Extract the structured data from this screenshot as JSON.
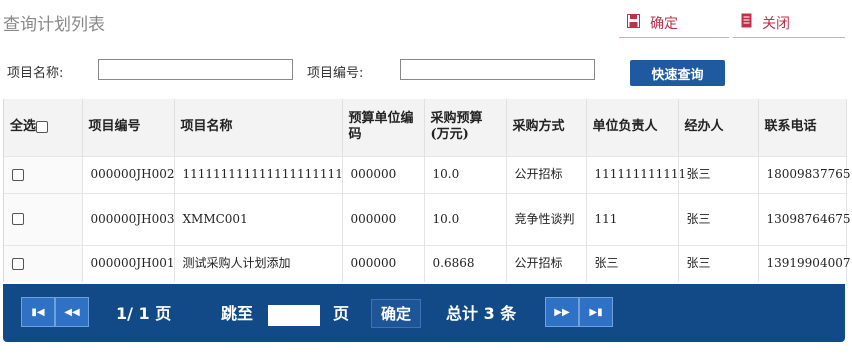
{
  "header": {
    "title": "查询计划列表",
    "confirm_label": "确定",
    "close_label": "关闭",
    "confirm_icon": "save-icon",
    "close_icon": "document-icon",
    "accent": "#c0304a"
  },
  "search": {
    "name_label": "项目名称:",
    "name_value": "",
    "code_label": "项目编号:",
    "code_value": "",
    "button_label": "快速查询"
  },
  "table": {
    "headers": [
      "全选",
      "项目编号",
      "项目名称",
      "预算单位编码",
      "采购预算(万元)",
      "采购方式",
      "单位负责人",
      "经办人",
      "联系电话"
    ],
    "rows": [
      [
        "",
        "000000JH002",
        "111111111111111111111",
        "000000",
        "10.0",
        "公开招标",
        "111111111111",
        "张三",
        "18009837765"
      ],
      [
        "",
        "000000JH003",
        "XMMC001",
        "000000",
        "10.0",
        "竞争性谈判",
        "111",
        "张三",
        "13098764675"
      ],
      [
        "",
        "000000JH001",
        "测试采购人计划添加",
        "000000",
        "0.6868",
        "公开招标",
        "张三",
        "张三",
        "13919904007"
      ]
    ]
  },
  "pager": {
    "page_info": "1/ 1 页",
    "jump_label": "跳至",
    "jump_value": "",
    "page_unit": "页",
    "confirm_label": "确定",
    "total_text": "总计 3 条",
    "bg_color": "#124a88",
    "icons": [
      "first-page-icon",
      "prev-page-icon",
      "next-page-icon",
      "last-page-icon"
    ]
  }
}
